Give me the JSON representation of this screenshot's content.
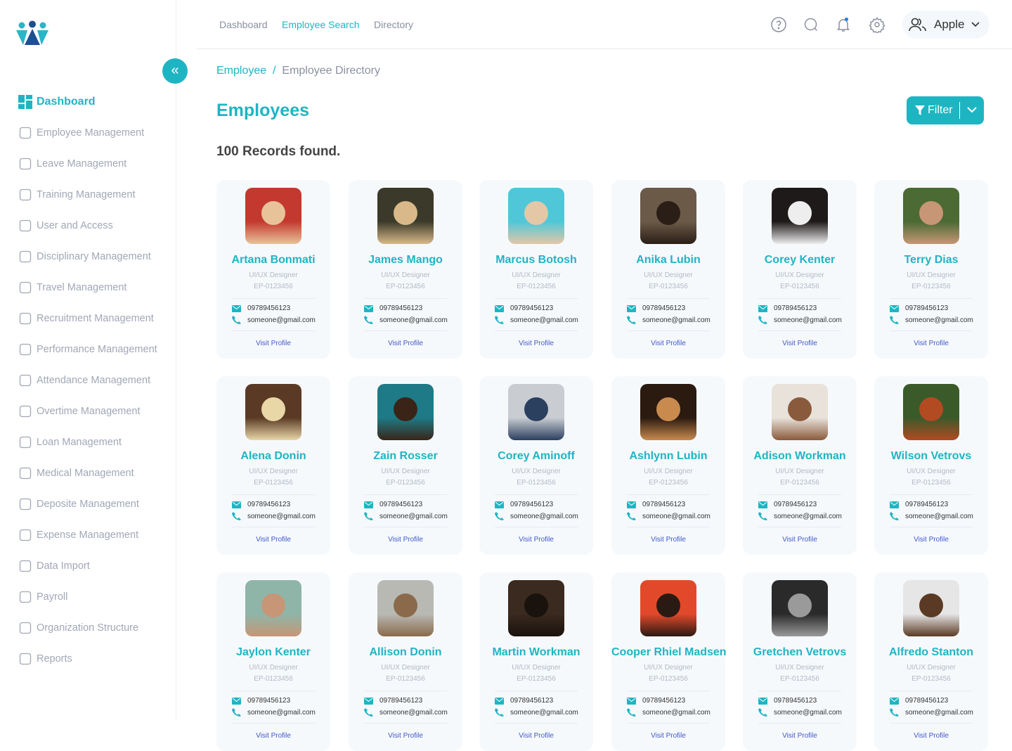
{
  "sidebar": {
    "items": [
      {
        "label": "Dashboard",
        "icon": "dashboard-icon",
        "active": true
      },
      {
        "label": "Employee Management",
        "icon": "users-icon"
      },
      {
        "label": "Leave Management",
        "icon": "leave-icon"
      },
      {
        "label": "Training Management",
        "icon": "training-icon"
      },
      {
        "label": "User and Access",
        "icon": "user-lock-icon"
      },
      {
        "label": "Disciplinary Management",
        "icon": "disciplinary-icon"
      },
      {
        "label": "Travel Management",
        "icon": "luggage-icon"
      },
      {
        "label": "Recruitment Management",
        "icon": "recruit-icon"
      },
      {
        "label": "Performance Management",
        "icon": "chart-icon"
      },
      {
        "label": "Attendance Management",
        "icon": "clock-icon"
      },
      {
        "label": "Overtime Management",
        "icon": "moon-icon"
      },
      {
        "label": "Loan Management",
        "icon": "dollar-icon"
      },
      {
        "label": "Medical Management",
        "icon": "medical-icon"
      },
      {
        "label": "Deposite Management",
        "icon": "database-icon"
      },
      {
        "label": "Expense Management",
        "icon": "expense-icon"
      },
      {
        "label": "Data Import",
        "icon": "import-icon"
      },
      {
        "label": "Payroll",
        "icon": "payroll-icon"
      },
      {
        "label": "Organization Structure",
        "icon": "org-icon"
      },
      {
        "label": "Reports",
        "icon": "reports-icon"
      }
    ]
  },
  "topnav": [
    {
      "label": "Dashboard"
    },
    {
      "label": "Employee Search",
      "active": true
    },
    {
      "label": "Directory"
    }
  ],
  "user": {
    "name": "Apple"
  },
  "breadcrumb": {
    "parent": "Employee",
    "separator": "/",
    "current": "Employee Directory"
  },
  "page": {
    "title": "Employees",
    "records": "100 Records found.",
    "filter": "Filter"
  },
  "colors": {
    "accent": "#1eb5c3",
    "link": "#4059c9"
  },
  "employees": [
    {
      "name": "Artana Bonmati",
      "role": "UI/UX Designer",
      "id": "EP-0123456",
      "phone": "09789456123",
      "email": "someone@gmail.com",
      "link": "Visit Profile",
      "photo": [
        "#c4392f",
        "#e8c39a"
      ]
    },
    {
      "name": "James Mango",
      "role": "UI/UX Designer",
      "id": "EP-0123456",
      "phone": "09789456123",
      "email": "someone@gmail.com",
      "link": "Visit Profile",
      "photo": [
        "#3b3a2a",
        "#d9b98a"
      ]
    },
    {
      "name": "Marcus Botosh",
      "role": "UI/UX Designer",
      "id": "EP-0123456",
      "phone": "09789456123",
      "email": "someone@gmail.com",
      "link": "Visit Profile",
      "photo": [
        "#4fc7d9",
        "#e4c7a6"
      ]
    },
    {
      "name": "Anika Lubin",
      "role": "UI/UX Designer",
      "id": "EP-0123456",
      "phone": "09789456123",
      "email": "someone@gmail.com",
      "link": "Visit Profile",
      "photo": [
        "#6b5a48",
        "#2a1e16"
      ]
    },
    {
      "name": "Corey Kenter",
      "role": "UI/UX Designer",
      "id": "EP-0123456",
      "phone": "09789456123",
      "email": "someone@gmail.com",
      "link": "Visit Profile",
      "photo": [
        "#1f1a1a",
        "#eee"
      ]
    },
    {
      "name": "Terry Dias",
      "role": "UI/UX Designer",
      "id": "EP-0123456",
      "phone": "09789456123",
      "email": "someone@gmail.com",
      "link": "Visit Profile",
      "photo": [
        "#4b6a34",
        "#c79676"
      ]
    },
    {
      "name": "Alena Donin",
      "role": "UI/UX Designer",
      "id": "EP-0123456",
      "phone": "09789456123",
      "email": "someone@gmail.com",
      "link": "Visit Profile",
      "photo": [
        "#5a3a24",
        "#e9d7a8"
      ]
    },
    {
      "name": "Zain Rosser",
      "role": "UI/UX Designer",
      "id": "EP-0123456",
      "phone": "09789456123",
      "email": "someone@gmail.com",
      "link": "Visit Profile",
      "photo": [
        "#1e7a86",
        "#3a2418"
      ]
    },
    {
      "name": "Corey Aminoff",
      "role": "UI/UX Designer",
      "id": "EP-0123456",
      "phone": "09789456123",
      "email": "someone@gmail.com",
      "link": "Visit Profile",
      "photo": [
        "#c9cdd2",
        "#2b3f5f"
      ]
    },
    {
      "name": "Ashlynn Lubin",
      "role": "UI/UX Designer",
      "id": "EP-0123456",
      "phone": "09789456123",
      "email": "someone@gmail.com",
      "link": "Visit Profile",
      "photo": [
        "#2a1a10",
        "#c98a4e"
      ]
    },
    {
      "name": "Adison Workman",
      "role": "UI/UX Designer",
      "id": "EP-0123456",
      "phone": "09789456123",
      "email": "someone@gmail.com",
      "link": "Visit Profile",
      "photo": [
        "#e8e2da",
        "#8a5a3c"
      ]
    },
    {
      "name": "Wilson Vetrovs",
      "role": "UI/UX Designer",
      "id": "EP-0123456",
      "phone": "09789456123",
      "email": "someone@gmail.com",
      "link": "Visit Profile",
      "photo": [
        "#3b5a2a",
        "#b24a22"
      ]
    },
    {
      "name": "Jaylon Kenter",
      "role": "UI/UX Designer",
      "id": "EP-0123456",
      "phone": "09789456123",
      "email": "someone@gmail.com",
      "link": "Visit Profile",
      "photo": [
        "#8fb5a8",
        "#c79676"
      ]
    },
    {
      "name": "Allison Donin",
      "role": "UI/UX Designer",
      "id": "EP-0123456",
      "phone": "09789456123",
      "email": "someone@gmail.com",
      "link": "Visit Profile",
      "photo": [
        "#b9b9b4",
        "#8a6a4a"
      ]
    },
    {
      "name": "Martin Workman",
      "role": "UI/UX Designer",
      "id": "EP-0123456",
      "phone": "09789456123",
      "email": "someone@gmail.com",
      "link": "Visit Profile",
      "photo": [
        "#3a2a20",
        "#1a120c"
      ]
    },
    {
      "name": "Cooper Rhiel Madsen",
      "role": "UI/UX Designer",
      "id": "EP-0123456",
      "phone": "09789456123",
      "email": "someone@gmail.com",
      "link": "Visit Profile",
      "photo": [
        "#e2492a",
        "#2a1a14"
      ]
    },
    {
      "name": "Gretchen Vetrovs",
      "role": "UI/UX Designer",
      "id": "EP-0123456",
      "phone": "09789456123",
      "email": "someone@gmail.com",
      "link": "Visit Profile",
      "photo": [
        "#2a2a2a",
        "#9a9a9a"
      ]
    },
    {
      "name": "Alfredo Stanton",
      "role": "UI/UX Designer",
      "id": "EP-0123456",
      "phone": "09789456123",
      "email": "someone@gmail.com",
      "link": "Visit Profile",
      "photo": [
        "#e6e6e6",
        "#5a3a24"
      ]
    }
  ]
}
